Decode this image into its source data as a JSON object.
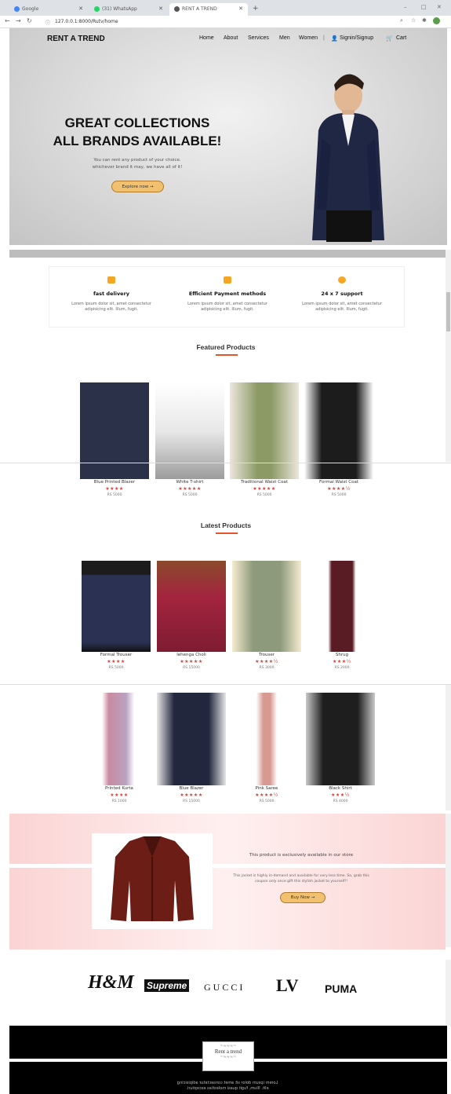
{
  "browser": {
    "tabs": [
      {
        "label": "Google",
        "color": "#4285f4"
      },
      {
        "label": "(31) WhatsApp",
        "color": "#25d366"
      },
      {
        "label": "RENT A TREND",
        "color": "#555555"
      }
    ],
    "url": "127.0.0.1:8000/Rutv/home"
  },
  "header": {
    "brand": "RENT A TREND",
    "menu": [
      "Home",
      "About",
      "Services",
      "Men",
      "Women",
      "|",
      "Signin/Signup",
      "Cart"
    ]
  },
  "hero": {
    "line1": "GREAT COLLECTIONS",
    "line2": "ALL BRANDS AVAILABLE!",
    "desc1": "You can rent any product of your choice.",
    "desc2": "whichever brand it may, we have all of it!",
    "cta": "Explore now →"
  },
  "features": [
    {
      "title": "fast delivery",
      "desc1": "Lorem ipsum dolor sit, amet consectetur",
      "desc2": "adipisicing elit. Illum, fugit.",
      "icon": "truck-icon"
    },
    {
      "title": "Efficient Payment methods",
      "desc1": "Lorem ipsum dolor sit, amet consectetur",
      "desc2": "adipisicing elit. Illum, fugit.",
      "icon": "card-icon"
    },
    {
      "title": "24 x 7 support",
      "desc1": "Lorem ipsum dolor sit, amet consectetur",
      "desc2": "adipisicing elit. Illum, fugit.",
      "icon": "headset-icon"
    }
  ],
  "featured": {
    "title": "Featured Products",
    "items": [
      {
        "name": "Blue Printed Blazer",
        "stars": "★★★★",
        "price": "RS 5000",
        "color": "#2a3148"
      },
      {
        "name": "White T-shirt",
        "stars": "★★★★★",
        "price": "RS 5000",
        "color": "#d9d9d9"
      },
      {
        "name": "Traditional Waist Coat",
        "stars": "★★★★★",
        "price": "RS 5000",
        "color": "#8c9a66"
      },
      {
        "name": "Formal Waist Coat",
        "stars": "★★★★½",
        "price": "RS 5000",
        "color": "#1c1c1c"
      }
    ]
  },
  "latest": {
    "title": "Latest Products",
    "row1": [
      {
        "name": "Formal Trouser",
        "stars": "★★★★",
        "price": "RS 5000",
        "color": "#2b3152"
      },
      {
        "name": "lehenga Choli",
        "stars": "★★★★★",
        "price": "RS 15000",
        "color": "#a3243e"
      },
      {
        "name": "Trouser",
        "stars": "★★★★½",
        "price": "RS 3000",
        "color": "#8e9a7c"
      },
      {
        "name": "Shrug",
        "stars": "★★★½",
        "price": "RS 2000",
        "color": "#5a1c24"
      }
    ],
    "row2": [
      {
        "name": "Printed Kurta",
        "stars": "★★★★",
        "price": "RS 1000",
        "color": "#c98aa0"
      },
      {
        "name": "Blue Blazer",
        "stars": "★★★★★",
        "price": "RS 15000",
        "color": "#22273d"
      },
      {
        "name": "Pink Saree",
        "stars": "★★★★½",
        "price": "RS 5000",
        "color": "#d79a92"
      },
      {
        "name": "Black Shirt",
        "stars": "★★★½",
        "price": "RS 4000",
        "color": "#1e1e1e"
      }
    ]
  },
  "promo": {
    "headline": "This product is exclusively available in our store",
    "desc1": "This jacket is highly in-demand and available for very less time. So, grab this",
    "desc2": "coupon only once gift this stylish jacket to yourself!!",
    "cta": "Buy Now →"
  },
  "brands": [
    "H&M",
    "Supreme",
    "GUCCI",
    "LV",
    "PUMA"
  ],
  "footer": {
    "logo": "Rent a trend",
    "line1": "Lorem ipsum dolor sit amet consectetur adipisicing",
    "line2": "elit. Illum, fugit quasi molestias excepturi."
  }
}
